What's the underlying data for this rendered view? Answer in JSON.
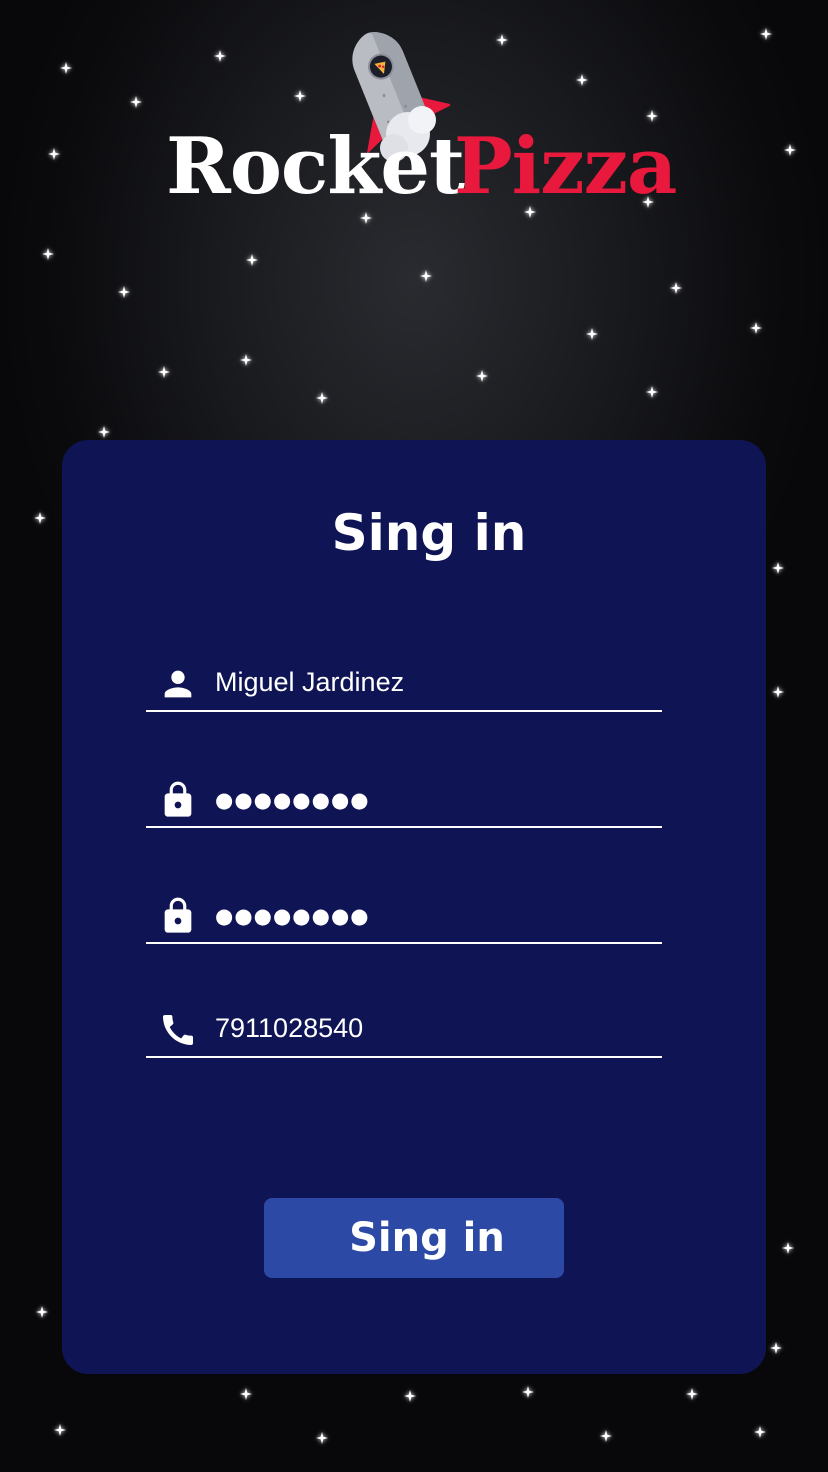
{
  "brand": {
    "name_part1": "Rocket",
    "name_part2": "Pizza",
    "accent_color": "#e8193c"
  },
  "theme": {
    "background": "#0b0b0e",
    "card_background": "#0f1454",
    "button_background": "#2c49a6",
    "text_color": "#ffffff"
  },
  "form": {
    "title": "Sing in",
    "fields": [
      {
        "icon": "user-icon",
        "value": "Miguel Jardinez",
        "masked": false
      },
      {
        "icon": "lock-icon",
        "value": "●●●●●●●●",
        "masked": true
      },
      {
        "icon": "lock-icon",
        "value": "●●●●●●●●",
        "masked": true
      },
      {
        "icon": "phone-icon",
        "value": "7911028540",
        "masked": false
      }
    ],
    "submit_label": "Sing in"
  }
}
